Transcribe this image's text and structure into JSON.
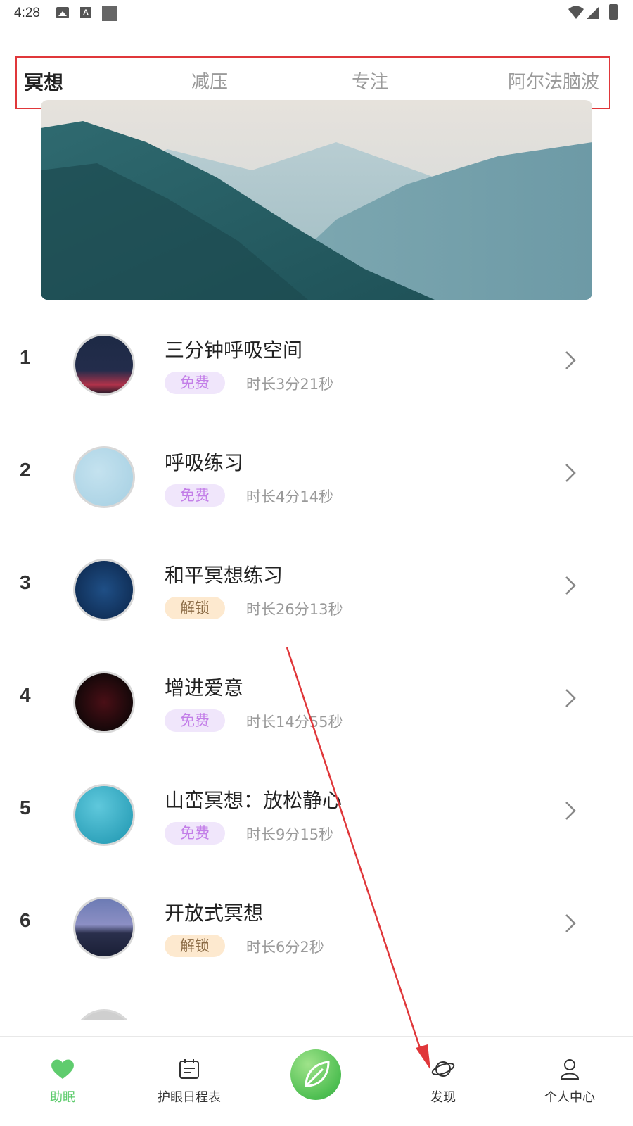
{
  "status_bar": {
    "time": "4:28",
    "icons": [
      "image-icon",
      "a-icon",
      "square-icon",
      "wifi-icon",
      "cell-signal-icon",
      "battery-icon"
    ]
  },
  "tabs": [
    {
      "label": "冥想",
      "active": true
    },
    {
      "label": "减压",
      "active": false
    },
    {
      "label": "专注",
      "active": false
    },
    {
      "label": "阿尔法脑波",
      "active": false
    }
  ],
  "list": {
    "items": [
      {
        "rank": "1",
        "title": "三分钟呼吸空间",
        "badge": "免费",
        "duration": "时长3分21秒",
        "thumb": "night-sky-red-horizon"
      },
      {
        "rank": "2",
        "title": "呼吸练习",
        "badge": "免费",
        "duration": "时长4分14秒",
        "thumb": "light-blue-sky"
      },
      {
        "rank": "3",
        "title": "和平冥想练习",
        "badge": "解锁",
        "duration": "时长26分13秒",
        "thumb": "deep-blue-stars"
      },
      {
        "rank": "4",
        "title": "增进爱意",
        "badge": "免费",
        "duration": "时长14分55秒",
        "thumb": "dark-red-heart"
      },
      {
        "rank": "5",
        "title": "山峦冥想：放松静心",
        "badge": "免费",
        "duration": "时长9分15秒",
        "thumb": "turquoise-water"
      },
      {
        "rank": "6",
        "title": "开放式冥想",
        "badge": "解锁",
        "duration": "时长6分2秒",
        "thumb": "lake-dusk"
      }
    ]
  },
  "bottom_nav": {
    "items": [
      {
        "label": "助眠",
        "icon": "heart-icon",
        "active": true
      },
      {
        "label": "护眼日程表",
        "icon": "calendar-icon",
        "active": false
      },
      {
        "label": "",
        "icon": "leaf-icon",
        "active": false
      },
      {
        "label": "发现",
        "icon": "planet-icon",
        "active": false
      },
      {
        "label": "个人中心",
        "icon": "person-icon",
        "active": false
      }
    ]
  },
  "colors": {
    "accent_green": "#5fcc6e",
    "free_badge_bg": "#f0e6fb",
    "free_badge_text": "#c37ee8",
    "lock_badge_bg": "#fde9cf",
    "annotation_red": "#e0373a"
  }
}
